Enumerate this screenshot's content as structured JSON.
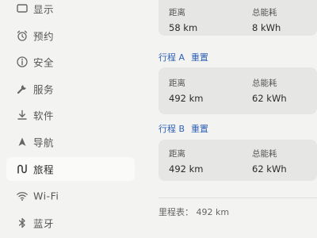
{
  "sidebar": {
    "items": [
      {
        "label": "显示",
        "icon": "display-icon",
        "active": false
      },
      {
        "label": "预约",
        "icon": "alarm-clock-icon",
        "active": false
      },
      {
        "label": "安全",
        "icon": "info-circle-icon",
        "active": false
      },
      {
        "label": "服务",
        "icon": "wrench-icon",
        "active": false
      },
      {
        "label": "软件",
        "icon": "download-icon",
        "active": false
      },
      {
        "label": "导航",
        "icon": "navigation-arrow-icon",
        "active": false
      },
      {
        "label": "旅程",
        "icon": "trip-icon",
        "active": true
      },
      {
        "label": "Wi-Fi",
        "icon": "wifi-icon",
        "active": false
      },
      {
        "label": "蓝牙",
        "icon": "bluetooth-icon",
        "active": false
      }
    ]
  },
  "main": {
    "top_card": {
      "distance_label": "距离",
      "distance_value": "58 km",
      "energy_label": "总能耗",
      "energy_value": "8 kWh"
    },
    "trip_a": {
      "title": "行程 A",
      "reset_label": "重置",
      "distance_label": "距离",
      "distance_value": "492 km",
      "energy_label": "总能耗",
      "energy_value": "62 kWh"
    },
    "trip_b": {
      "title": "行程 B",
      "reset_label": "重置",
      "distance_label": "距离",
      "distance_value": "492 km",
      "energy_label": "总能耗",
      "energy_value": "62 kWh"
    },
    "odometer": "里程表：  492 km"
  },
  "colors": {
    "accent": "#2e62b7",
    "background": "#f3f3f2",
    "card": "#e6e6e5",
    "active_item": "#fafaf9"
  }
}
